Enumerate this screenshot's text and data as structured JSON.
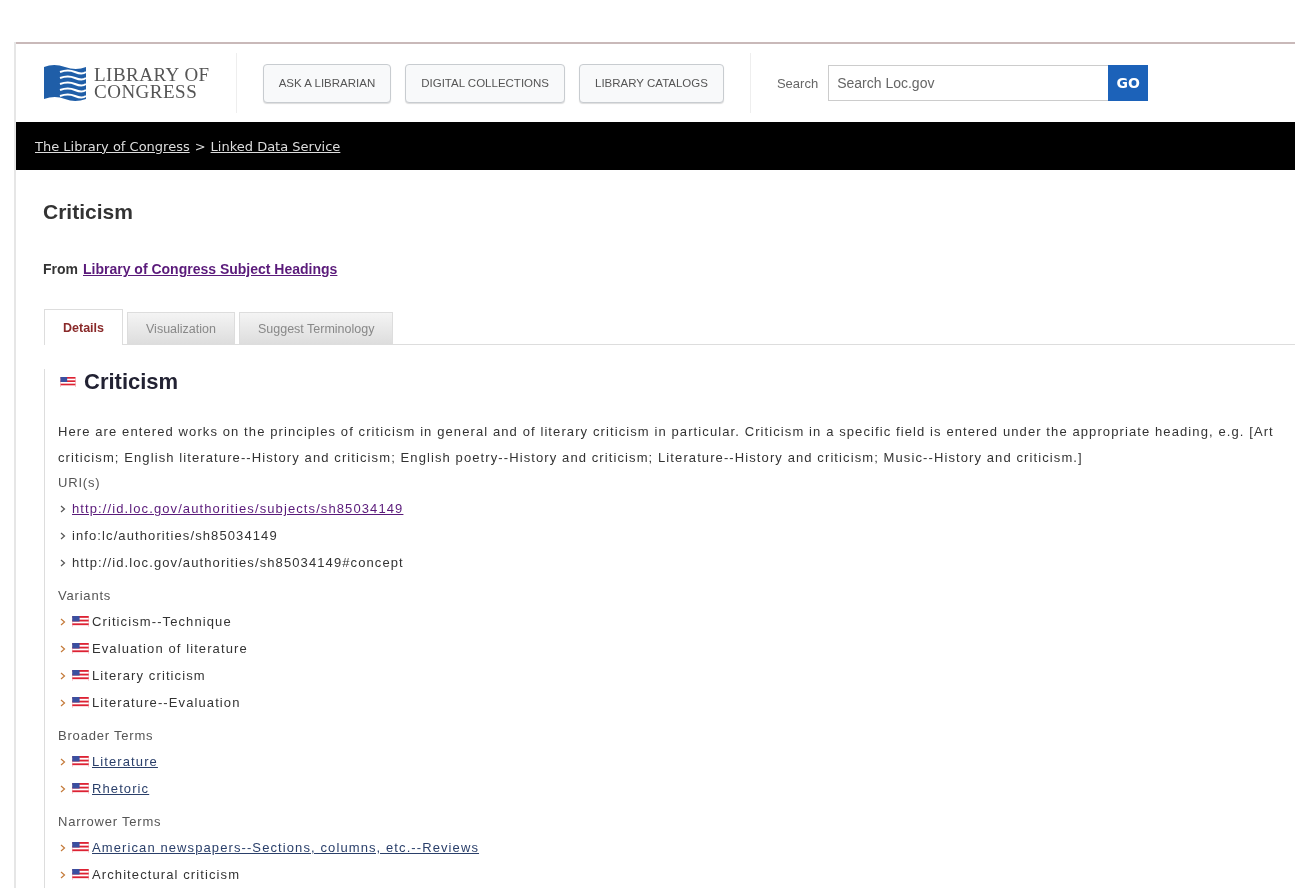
{
  "header": {
    "logo_lines": [
      "LIBRARY OF",
      "CONGRESS"
    ],
    "nav_buttons": [
      "ASK A LIBRARIAN",
      "DIGITAL COLLECTIONS",
      "LIBRARY CATALOGS"
    ],
    "search_label": "Search",
    "search": {
      "placeholder": "Search Loc.gov"
    },
    "go_button": "GO"
  },
  "breadcrumb": {
    "items": [
      "The Library of Congress",
      "Linked Data Service"
    ],
    "separator": ">"
  },
  "page_title": "Criticism",
  "source": {
    "prefix": "From",
    "link": "Library of Congress Subject Headings"
  },
  "tabs": [
    {
      "label": "Details",
      "selected": true
    },
    {
      "label": "Visualization",
      "selected": false
    },
    {
      "label": "Suggest Terminology",
      "selected": false
    }
  ],
  "heading": "Criticism",
  "description": "Here are entered works on the principles of criticism in general and of literary criticism in particular. Criticism in a specific field is entered under the appropriate heading, e.g. [Art criticism; English literature--History and criticism; English poetry--History and criticism; Literature--History and criticism; Music--History and criticism.]",
  "uris": {
    "title": "URI(s)",
    "items": [
      {
        "text": "http://id.loc.gov/authorities/subjects/sh85034149",
        "link": true
      },
      {
        "text": "info:lc/authorities/sh85034149",
        "link": false
      },
      {
        "text": "http://id.loc.gov/authorities/sh85034149#concept",
        "link": false
      }
    ]
  },
  "sections": [
    {
      "title": "Variants",
      "items": [
        {
          "text": "Criticism--Technique",
          "link": false
        },
        {
          "text": "Evaluation of literature",
          "link": false
        },
        {
          "text": "Literary criticism",
          "link": false
        },
        {
          "text": "Literature--Evaluation",
          "link": false
        }
      ]
    },
    {
      "title": "Broader Terms",
      "items": [
        {
          "text": "Literature",
          "link": true
        },
        {
          "text": "Rhetoric",
          "link": true
        }
      ]
    },
    {
      "title": "Narrower Terms",
      "items": [
        {
          "text": "American newspapers--Sections, columns, etc.--Reviews",
          "link": true
        },
        {
          "text": "Architectural criticism",
          "link": false
        }
      ]
    }
  ]
}
